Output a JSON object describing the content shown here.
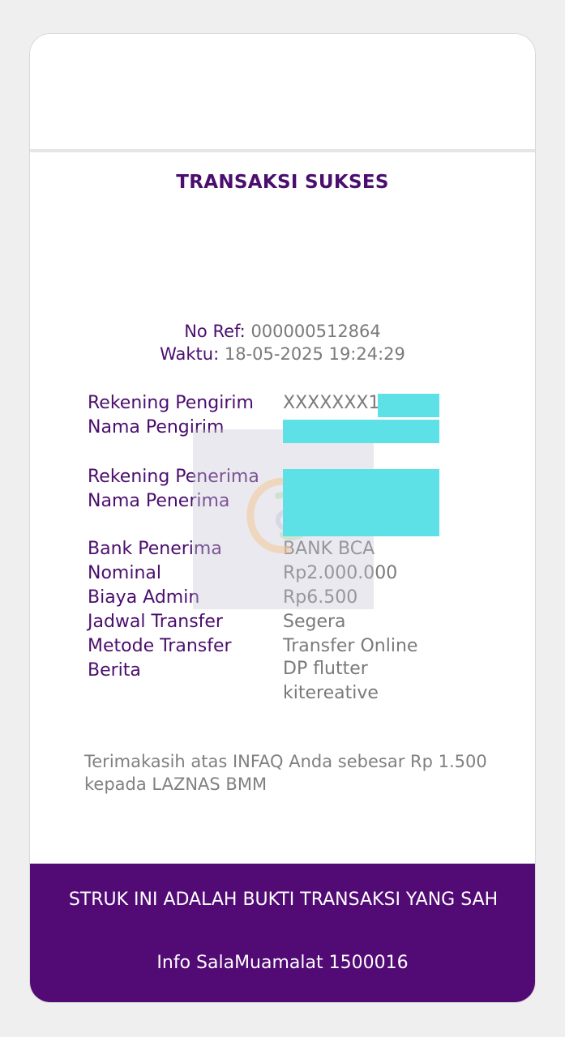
{
  "receipt": {
    "title": "TRANSAKSI SUKSES",
    "ref_label": "No Ref:",
    "ref_value": "000000512864",
    "time_label": "Waktu:",
    "time_value": "18-05-2025 19:24:29",
    "rows": {
      "sender_account_label": "Rekening Pengirim",
      "sender_account_value": "XXXXXXX1",
      "sender_name_label": "Nama Pengirim",
      "recipient_account_label": "Rekening Penerima",
      "recipient_name_label": "Nama Penerima",
      "bank_label": "Bank Penerima",
      "bank_value": "BANK BCA",
      "nominal_label": "Nominal",
      "nominal_value": "Rp2.000.000",
      "admin_fee_label": "Biaya Admin",
      "admin_fee_value": "Rp6.500",
      "schedule_label": "Jadwal Transfer",
      "schedule_value": "Segera",
      "method_label": "Metode Transfer",
      "method_value": "Transfer Online",
      "message_label": "Berita",
      "message_value": "DP flutter kitereative"
    },
    "thanks_note": "Terimakasih atas INFAQ Anda sebesar Rp 1.500 kepada LAZNAS BMM",
    "footer_statement": "STRUK INI ADALAH BUKTI TRANSAKSI YANG SAH",
    "footer_info": "Info SalaMuamalat 1500016"
  },
  "colors": {
    "brand_purple": "#520a75",
    "label_purple": "#4b0e6e",
    "value_gray": "#7a7a7a",
    "redaction_cyan": "#5ee1e6"
  },
  "icons": {
    "watermark": "muamalat-logo-icon"
  }
}
